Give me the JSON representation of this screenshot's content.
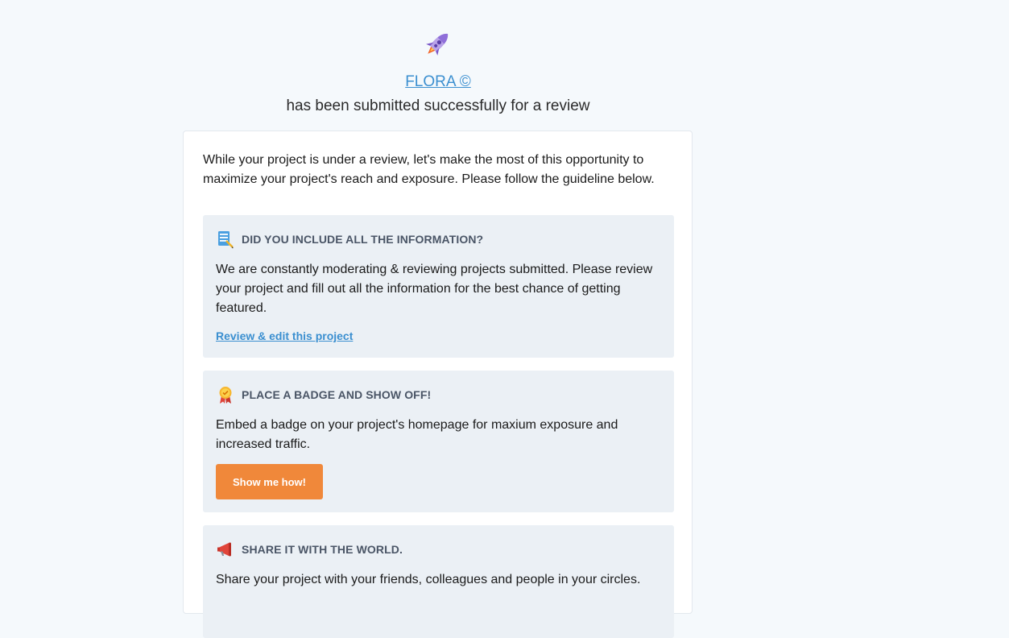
{
  "header": {
    "project_name": "FLORA ©",
    "subtitle": "has been submitted successfully for a review",
    "icon": "rocket-icon"
  },
  "card": {
    "intro": "While your project is under a review, let's make the most of this opportunity to maximize your project's reach and exposure. Please follow the guideline below.",
    "sections": [
      {
        "icon": "checklist-icon",
        "title": "DID YOU INCLUDE ALL THE INFORMATION?",
        "body": "We are constantly moderating & reviewing projects submitted. Please review your project and fill out all the information for the best chance of getting featured.",
        "link": "Review & edit this project"
      },
      {
        "icon": "badge-icon",
        "title": "PLACE A BADGE AND SHOW OFF!",
        "body": "Embed a badge on your project's homepage for maxium exposure and increased traffic.",
        "button": "Show me how!"
      },
      {
        "icon": "megaphone-icon",
        "title": "SHARE IT WITH THE WORLD.",
        "body": "Share your project with your friends, colleagues and people in your circles."
      }
    ]
  },
  "colors": {
    "background": "#f5f9fc",
    "link": "#3b8fd0",
    "section_bg": "#ebf0f5",
    "button": "#f0883a"
  }
}
